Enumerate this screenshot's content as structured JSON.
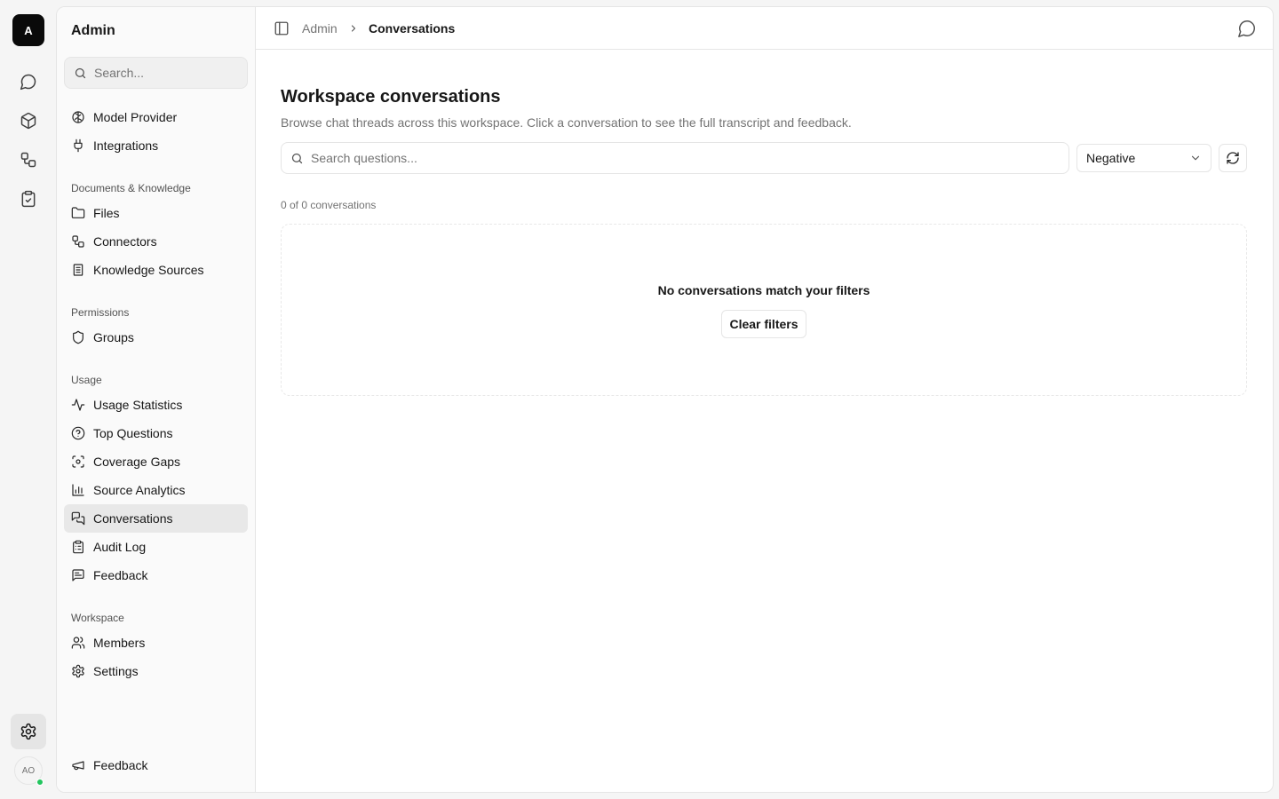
{
  "rail": {
    "logo_letter": "A",
    "avatar_initials": "AO",
    "icons": [
      "chat-icon",
      "box-icon",
      "workflow-icon",
      "clipboard-check-icon",
      "gear-icon"
    ]
  },
  "sidebar": {
    "title": "Admin",
    "search_placeholder": "Search...",
    "items_top": [
      {
        "label": "Model Provider",
        "icon": "brain-icon"
      },
      {
        "label": "Integrations",
        "icon": "plug-icon"
      }
    ],
    "sections": [
      {
        "label": "Documents & Knowledge",
        "items": [
          {
            "label": "Files",
            "icon": "folder-icon"
          },
          {
            "label": "Connectors",
            "icon": "workflow-icon"
          },
          {
            "label": "Knowledge Sources",
            "icon": "book-icon"
          }
        ]
      },
      {
        "label": "Permissions",
        "items": [
          {
            "label": "Groups",
            "icon": "shield-icon"
          }
        ]
      },
      {
        "label": "Usage",
        "items": [
          {
            "label": "Usage Statistics",
            "icon": "activity-icon"
          },
          {
            "label": "Top Questions",
            "icon": "help-circle-icon"
          },
          {
            "label": "Coverage Gaps",
            "icon": "scan-icon"
          },
          {
            "label": "Source Analytics",
            "icon": "bar-chart-icon"
          },
          {
            "label": "Conversations",
            "icon": "messages-icon",
            "active": true
          },
          {
            "label": "Audit Log",
            "icon": "clipboard-list-icon"
          },
          {
            "label": "Feedback",
            "icon": "message-square-text-icon"
          }
        ]
      },
      {
        "label": "Workspace",
        "items": [
          {
            "label": "Members",
            "icon": "users-icon"
          },
          {
            "label": "Settings",
            "icon": "gear-icon"
          }
        ]
      }
    ],
    "footer_item": {
      "label": "Feedback",
      "icon": "megaphone-icon"
    }
  },
  "topbar": {
    "breadcrumb_root": "Admin",
    "breadcrumb_current": "Conversations"
  },
  "main": {
    "title": "Workspace conversations",
    "subtitle": "Browse chat threads across this workspace. Click a conversation to see the full transcript and feedback.",
    "search_placeholder": "Search questions...",
    "filter_value": "Negative",
    "count_text": "0 of 0 conversations",
    "empty_title": "No conversations match your filters",
    "clear_button": "Clear filters"
  }
}
